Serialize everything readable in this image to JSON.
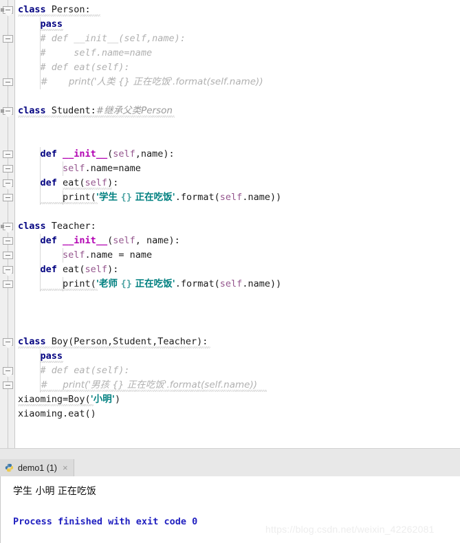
{
  "editor": {
    "language": "python",
    "lines": [
      {
        "indent": 0,
        "segs": [
          {
            "t": "class",
            "c": "kw"
          },
          {
            "t": " Person:",
            "c": "plain"
          }
        ]
      },
      {
        "indent": 1,
        "segs": [
          {
            "t": "pass",
            "c": "kw"
          }
        ]
      },
      {
        "indent": 1,
        "segs": [
          {
            "t": "# def __init__(self,name):",
            "c": "cmt"
          }
        ]
      },
      {
        "indent": 1,
        "segs": [
          {
            "t": "#     self.name=name",
            "c": "cmt"
          }
        ]
      },
      {
        "indent": 1,
        "segs": [
          {
            "t": "# def eat(self):",
            "c": "cmt"
          }
        ]
      },
      {
        "indent": 1,
        "segs": [
          {
            "t": "#       print('人类 {} 正在吃饭'.format(self.name))",
            "c": "cmt"
          }
        ]
      },
      {
        "indent": 0,
        "segs": []
      },
      {
        "indent": 0,
        "segs": [
          {
            "t": "class",
            "c": "kw"
          },
          {
            "t": " Student:",
            "c": "plain"
          },
          {
            "t": "#继承父类Person",
            "c": "cmt2"
          }
        ]
      },
      {
        "indent": 0,
        "segs": []
      },
      {
        "indent": 0,
        "segs": []
      },
      {
        "indent": 1,
        "segs": [
          {
            "t": "def",
            "c": "kw"
          },
          {
            "t": " ",
            "c": "plain"
          },
          {
            "t": "__init__",
            "c": "fn"
          },
          {
            "t": "(",
            "c": "plain"
          },
          {
            "t": "self",
            "c": "slf"
          },
          {
            "t": ",name):",
            "c": "plain"
          }
        ]
      },
      {
        "indent": 2,
        "segs": [
          {
            "t": "self",
            "c": "slf"
          },
          {
            "t": ".name=name",
            "c": "plain"
          }
        ]
      },
      {
        "indent": 1,
        "segs": [
          {
            "t": "def",
            "c": "kw"
          },
          {
            "t": " eat(",
            "c": "plain"
          },
          {
            "t": "self",
            "c": "slf"
          },
          {
            "t": "):",
            "c": "plain"
          }
        ]
      },
      {
        "indent": 2,
        "segs": [
          {
            "t": "print(",
            "c": "plain"
          },
          {
            "t": "'学生 ",
            "c": "str"
          },
          {
            "t": "{}",
            "c": "brc"
          },
          {
            "t": " 正在吃饭'",
            "c": "str"
          },
          {
            "t": ".format(",
            "c": "plain"
          },
          {
            "t": "self",
            "c": "slf"
          },
          {
            "t": ".name))",
            "c": "plain"
          }
        ]
      },
      {
        "indent": 0,
        "segs": []
      },
      {
        "indent": 0,
        "segs": [
          {
            "t": "class",
            "c": "kw"
          },
          {
            "t": " Teacher:",
            "c": "plain"
          }
        ]
      },
      {
        "indent": 1,
        "segs": [
          {
            "t": "def",
            "c": "kw"
          },
          {
            "t": " ",
            "c": "plain"
          },
          {
            "t": "__init__",
            "c": "fn"
          },
          {
            "t": "(",
            "c": "plain"
          },
          {
            "t": "self",
            "c": "slf"
          },
          {
            "t": ", name):",
            "c": "plain"
          }
        ]
      },
      {
        "indent": 2,
        "segs": [
          {
            "t": "self",
            "c": "slf"
          },
          {
            "t": ".name = name",
            "c": "plain"
          }
        ]
      },
      {
        "indent": 1,
        "segs": [
          {
            "t": "def",
            "c": "kw"
          },
          {
            "t": " eat(",
            "c": "plain"
          },
          {
            "t": "self",
            "c": "slf"
          },
          {
            "t": "):",
            "c": "plain"
          }
        ]
      },
      {
        "indent": 2,
        "segs": [
          {
            "t": "print(",
            "c": "plain"
          },
          {
            "t": "'老师 ",
            "c": "str"
          },
          {
            "t": "{}",
            "c": "brc"
          },
          {
            "t": " 正在吃饭'",
            "c": "str"
          },
          {
            "t": ".format(",
            "c": "plain"
          },
          {
            "t": "self",
            "c": "slf"
          },
          {
            "t": ".name))",
            "c": "plain"
          }
        ]
      },
      {
        "indent": 0,
        "segs": []
      },
      {
        "indent": 0,
        "segs": []
      },
      {
        "indent": 0,
        "segs": []
      },
      {
        "indent": 0,
        "segs": [
          {
            "t": "class",
            "c": "kw"
          },
          {
            "t": " Boy(Person,Student,Teacher):",
            "c": "plain"
          }
        ]
      },
      {
        "indent": 1,
        "segs": [
          {
            "t": "pass",
            "c": "kw"
          }
        ]
      },
      {
        "indent": 1,
        "segs": [
          {
            "t": "# def eat(self):",
            "c": "cmt"
          }
        ]
      },
      {
        "indent": 1,
        "segs": [
          {
            "t": "#     print('男孩 {} 正在吃饭'.format(self.name))",
            "c": "cmt"
          }
        ]
      },
      {
        "indent": 0,
        "segs": [
          {
            "t": "xiaoming=Boy(",
            "c": "plain"
          },
          {
            "t": "'小明'",
            "c": "str"
          },
          {
            "t": ")",
            "c": "plain"
          }
        ]
      },
      {
        "indent": 0,
        "segs": [
          {
            "t": "xiaoming.eat()",
            "c": "plain"
          }
        ]
      }
    ],
    "fold_markers_lines": [
      0,
      2,
      5,
      7,
      10,
      11,
      12,
      13,
      15,
      16,
      17,
      18,
      19,
      23,
      25,
      26
    ],
    "edge_markers_lines": [
      0,
      7,
      15
    ]
  },
  "console": {
    "tab": {
      "label": "demo1 (1)",
      "icon": "python-file-icon",
      "close_icon": "×"
    },
    "output": [
      {
        "text": "学生 小明 正在吃饭",
        "style": "cjk"
      },
      {
        "text": "",
        "style": "cjk"
      },
      {
        "text": "Process finished with exit code 0",
        "style": "blue"
      }
    ]
  },
  "watermark": {
    "text": "https://blog.csdn.net/weixin_42262081"
  },
  "colors": {
    "keyword": "#000080",
    "function": "#b200b2",
    "self": "#94558d",
    "string": "#008080",
    "comment": "#b0b0b0",
    "console_blue": "#2020c0",
    "gutter_bg": "#efefef",
    "tab_bg": "#dcdcdc"
  }
}
